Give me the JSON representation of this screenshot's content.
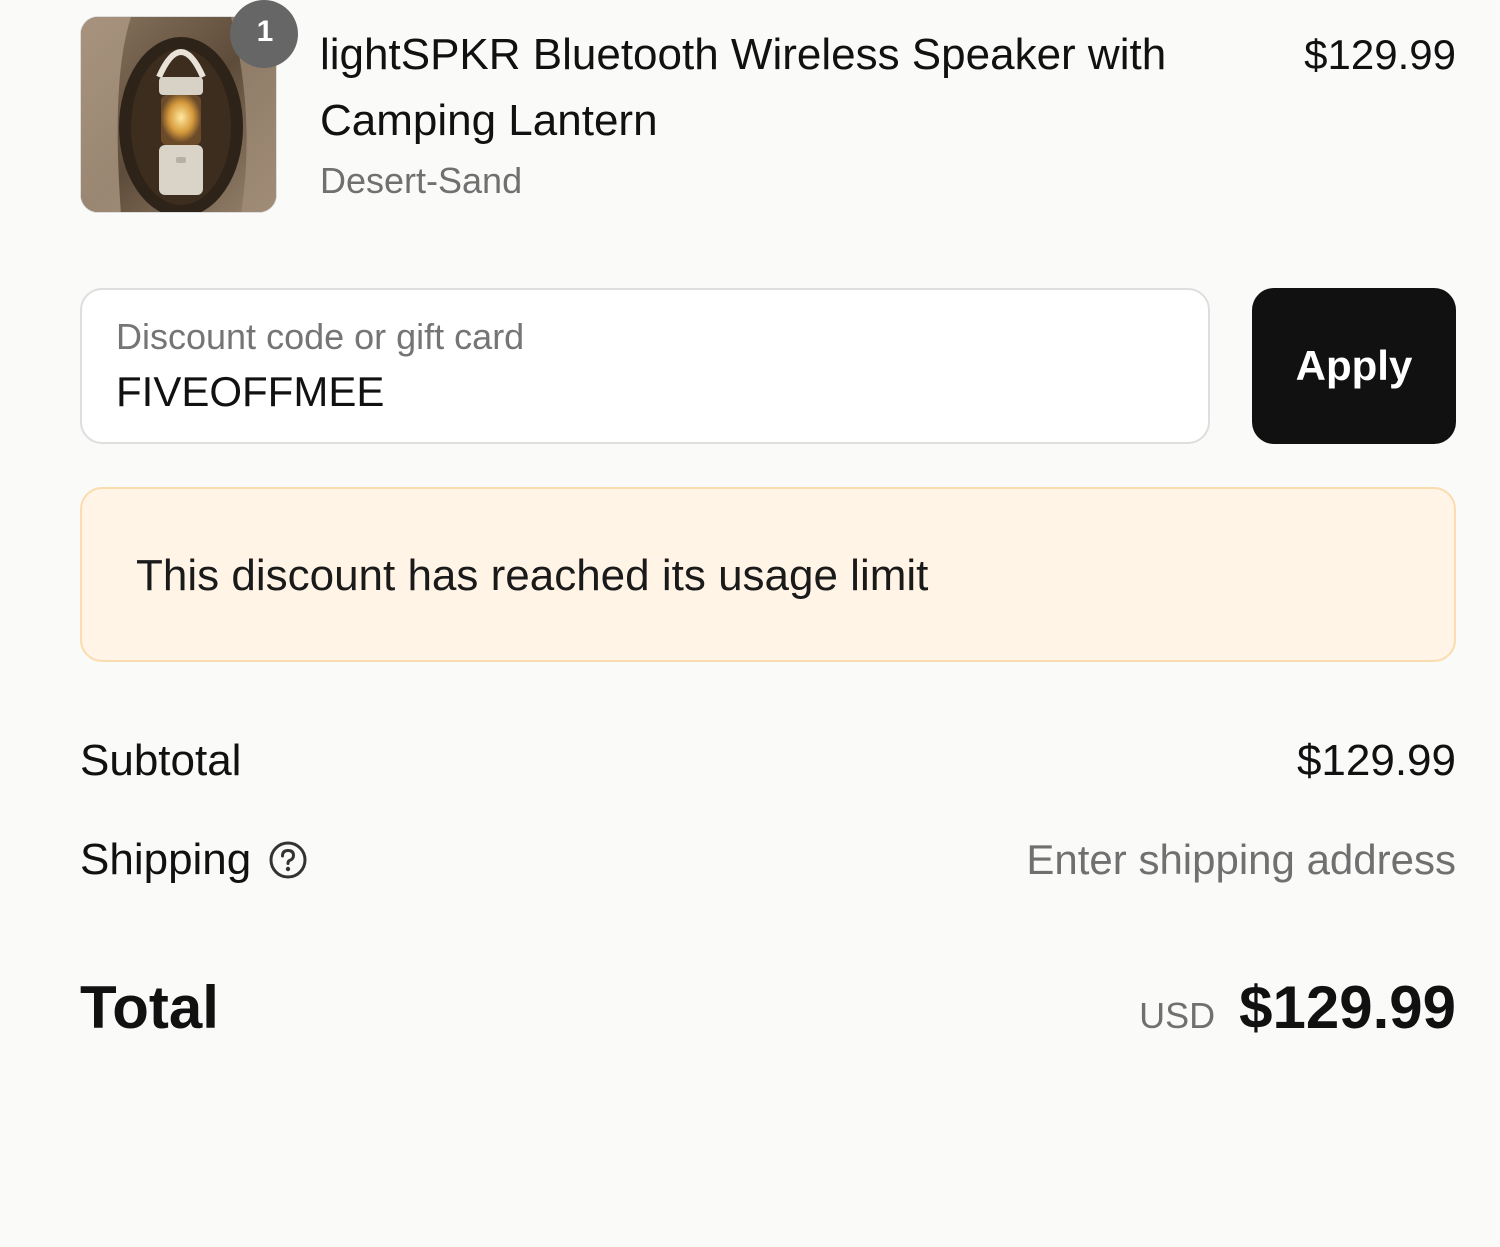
{
  "line_item": {
    "quantity": "1",
    "name": "lightSPKR Bluetooth Wireless Speaker with Camping Lantern",
    "variant": "Desert-Sand",
    "price": "$129.99"
  },
  "discount": {
    "label": "Discount code or gift card",
    "value": "FIVEOFFMEE",
    "apply_label": "Apply",
    "error_message": "This discount has reached its usage limit"
  },
  "summary": {
    "subtotal_label": "Subtotal",
    "subtotal_value": "$129.99",
    "shipping_label": "Shipping",
    "shipping_value": "Enter shipping address",
    "total_label": "Total",
    "currency": "USD",
    "total_value": "$129.99"
  },
  "colors": {
    "button_bg": "#111111",
    "warning_bg": "#fff4e6",
    "warning_border": "#fadcae"
  }
}
